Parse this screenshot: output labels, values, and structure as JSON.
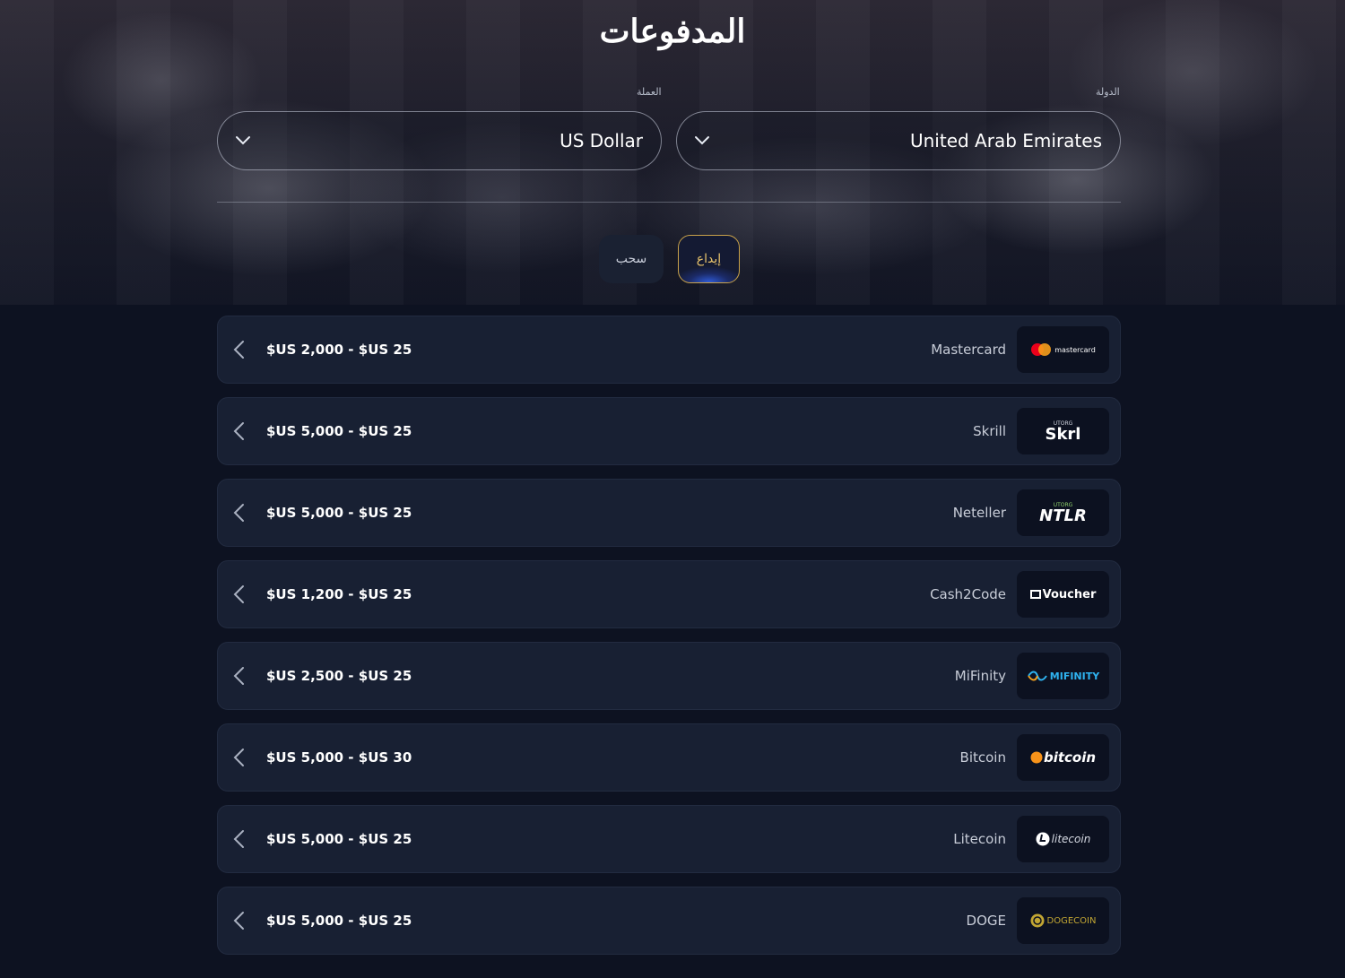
{
  "header": {
    "title": "المدفوعات"
  },
  "filters": {
    "currency_label": "العملة",
    "currency_value": "US Dollar",
    "country_label": "الدولة",
    "country_value": "United Arab Emirates"
  },
  "tabs": {
    "withdraw": "سحب",
    "deposit": "إيداع",
    "active": "deposit"
  },
  "methods": [
    {
      "name": "Mastercard",
      "limits": "$US 2,000 - $US 25",
      "logo": "mastercard-logo",
      "logo_text": "mastercard"
    },
    {
      "name": "Skrill",
      "limits": "$US 5,000 - $US 25",
      "logo": "skrill-logo",
      "logo_text": "Skrl",
      "logo_sub": "UTORG"
    },
    {
      "name": "Neteller",
      "limits": "$US 5,000 - $US 25",
      "logo": "neteller-logo",
      "logo_text": "NTLR",
      "logo_sub": "UTORG"
    },
    {
      "name": "Cash2Code",
      "limits": "$US 1,200 - $US 25",
      "logo": "voucher-logo",
      "logo_text": "Voucher"
    },
    {
      "name": "MiFinity",
      "limits": "$US 2,500 - $US 25",
      "logo": "mifinity-logo",
      "logo_text": "MIFINITY"
    },
    {
      "name": "Bitcoin",
      "limits": "$US 5,000 - $US 30",
      "logo": "bitcoin-logo",
      "logo_text": "bitcoin"
    },
    {
      "name": "Litecoin",
      "limits": "$US 5,000 - $US 25",
      "logo": "litecoin-logo",
      "logo_text": "litecoin"
    },
    {
      "name": "DOGE",
      "limits": "$US 5,000 - $US 25",
      "logo": "dogecoin-logo",
      "logo_text": "DOGECOIN"
    }
  ],
  "colors": {
    "background": "#0d1221",
    "row_bg": "#182033",
    "accent_gold": "#c9a24a",
    "accent_blue": "#2f5bd8"
  }
}
